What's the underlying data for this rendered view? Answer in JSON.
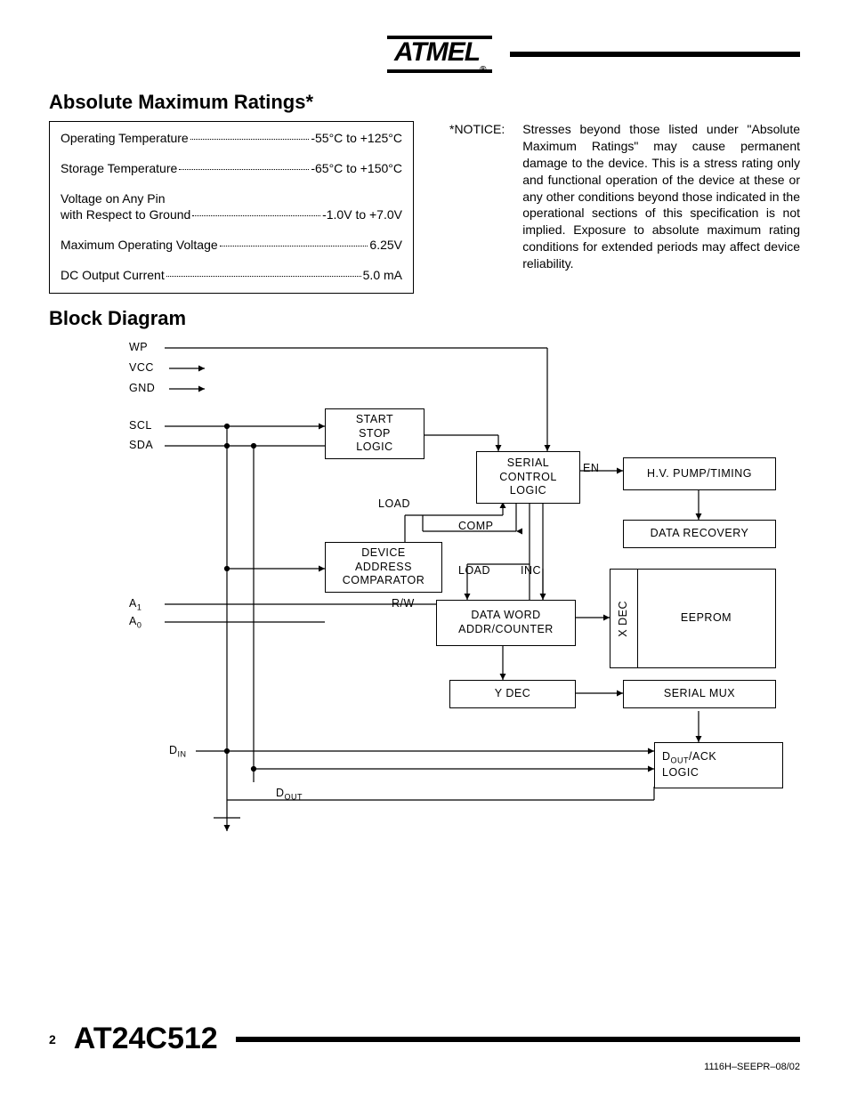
{
  "header": {
    "logo_text": "ATMEL",
    "reg": "®"
  },
  "sections": {
    "ratings_heading": "Absolute Maximum Ratings*",
    "block_heading": "Block Diagram"
  },
  "ratings": {
    "r1_label": "Operating Temperature",
    "r1_value": "-55°C to +125°C",
    "r2_label": "Storage Temperature",
    "r2_value": "-65°C to +150°C",
    "r3_label": "Voltage on Any Pin",
    "r3_sub_label": "with Respect to Ground",
    "r3_value": "-1.0V to +7.0V",
    "r4_label": "Maximum Operating Voltage",
    "r4_value": "6.25V",
    "r5_label": "DC Output Current",
    "r5_value": "5.0 mA"
  },
  "notice": {
    "label": "*NOTICE:",
    "text": "Stresses beyond those listed under \"Absolute Maximum Ratings\" may cause permanent damage to the device. This is a stress rating only and functional operation of the device at these or any other conditions beyond those indicated in the operational sections of this specification is not implied. Exposure to absolute maximum rating conditions for extended periods may affect device reliability."
  },
  "diagram": {
    "pins": {
      "wp": "WP",
      "vcc": "VCC",
      "gnd": "GND",
      "scl": "SCL",
      "sda": "SDA",
      "a1": "A",
      "a1_sub": "1",
      "a0": "A",
      "a0_sub": "0",
      "din": "D",
      "din_sub": "IN",
      "dout": "D",
      "dout_sub": "OUT"
    },
    "blocks": {
      "start_stop": "START\nSTOP\nLOGIC",
      "serial_control": "SERIAL\nCONTROL\nLOGIC",
      "hv": "H.V. PUMP/TIMING",
      "data_recovery": "DATA RECOVERY",
      "device_addr": "DEVICE\nADDRESS\nCOMPARATOR",
      "data_word": "DATA WORD\nADDR/COUNTER",
      "eeprom": "EEPROM",
      "ydec": "Y DEC",
      "serial_mux": "SERIAL MUX",
      "dout_ack": "/ACK\nLOGIC",
      "dout_ack_prefix": "D",
      "dout_ack_sub": "OUT",
      "xdec": "X DEC"
    },
    "labels": {
      "en": "EN",
      "load1": "LOAD",
      "comp": "COMP",
      "load2": "LOAD",
      "inc": "INC",
      "rw": "R/W"
    }
  },
  "footer": {
    "page": "2",
    "part": "AT24C512",
    "doccode": "1116H–SEEPR–08/02"
  }
}
